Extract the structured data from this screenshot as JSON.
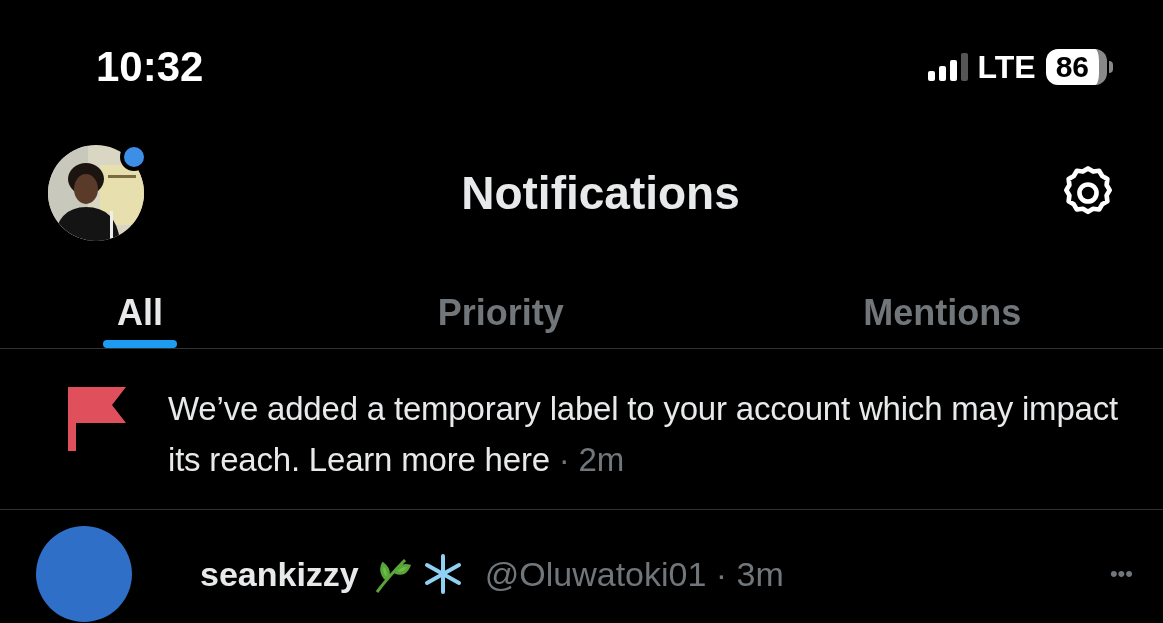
{
  "status_bar": {
    "time": "10:32",
    "network": "LTE",
    "battery": "86"
  },
  "header": {
    "title": "Notifications",
    "has_unread_dot": true
  },
  "tabs": [
    {
      "label": "All",
      "selected": true
    },
    {
      "label": "Priority",
      "selected": false
    },
    {
      "label": "Mentions",
      "selected": false
    }
  ],
  "notice": {
    "text": "We’ve added a temporary label to your account which may impact its reach.",
    "link": "Learn more here",
    "time": "· 2m"
  },
  "next_item": {
    "name": "seankizzy",
    "handle": "@Oluwatoki01 · 3m",
    "more": "•••"
  }
}
